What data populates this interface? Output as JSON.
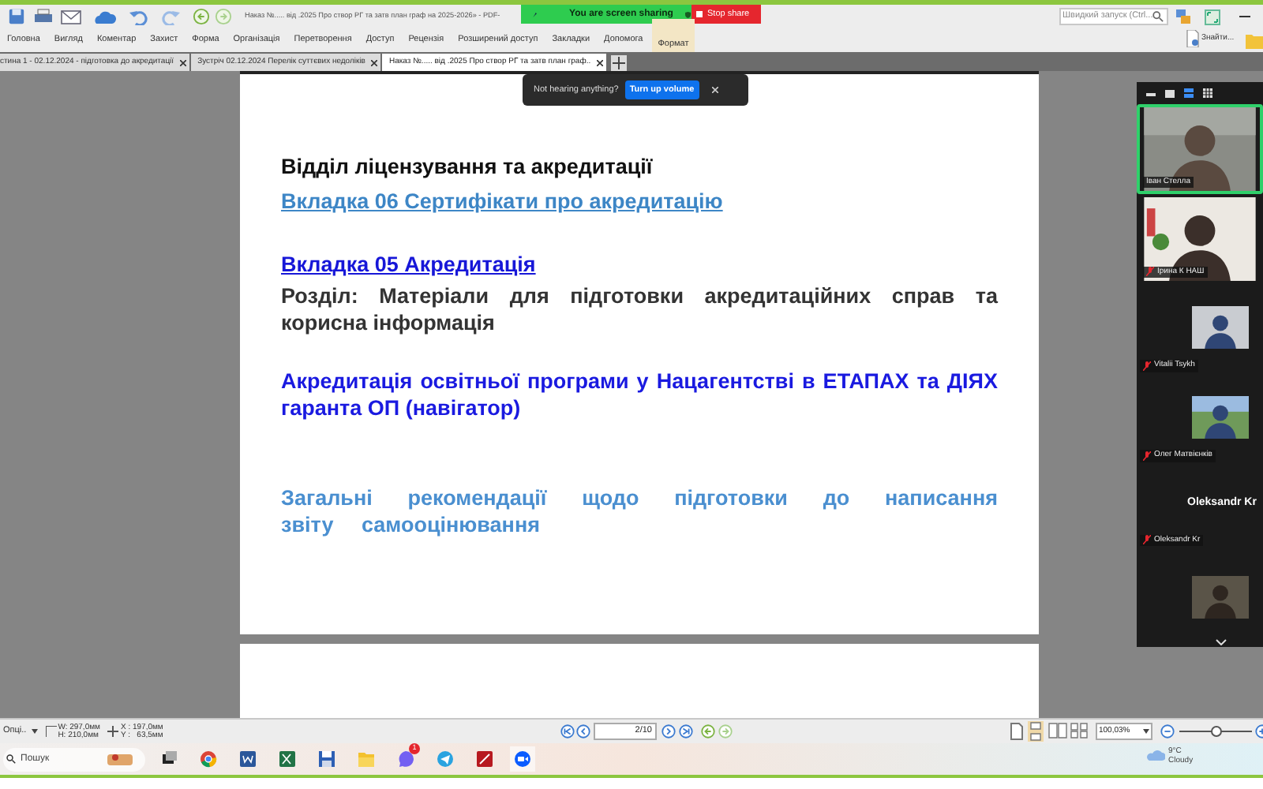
{
  "window": {
    "title": "Наказ №..... від .2025  Про створ РГ та затв план граф на 2025-2026» - PDF-"
  },
  "sharing_banner": {
    "text": "You are screen sharing",
    "stop_label": "Stop share"
  },
  "quick_launch": {
    "placeholder": "Швидкий запуск (Ctrl..."
  },
  "menu": [
    {
      "label": "Головна",
      "kind": "tab"
    },
    {
      "label": "Вигляд",
      "kind": "tab"
    },
    {
      "label": "Коментар",
      "kind": "tab"
    },
    {
      "label": "Захист",
      "kind": "tab"
    },
    {
      "label": "Форма",
      "kind": "tab"
    },
    {
      "label": "Організація",
      "kind": "tab"
    },
    {
      "label": "Перетворення",
      "kind": "tab"
    },
    {
      "label": "Доступ",
      "kind": "tab"
    },
    {
      "label": "Рецензія",
      "kind": "tab"
    },
    {
      "label": "Розширений доступ",
      "kind": "tab"
    },
    {
      "label": "Закладки",
      "kind": "tab"
    },
    {
      "label": "Допомога",
      "kind": "tab"
    },
    {
      "label": "Формат",
      "kind": "context"
    }
  ],
  "find_button": "Знайти...",
  "doc_tabs": [
    {
      "label": "стина 1 - 02.12.2024  - підготовка до акредитації",
      "selected": false
    },
    {
      "label": "Зустріч 02.12.2024 Перелік суттєвих недоліків",
      "selected": false
    },
    {
      "label": "Наказ №..... від .2025  Про створ РГ та затв план граф..",
      "selected": true
    }
  ],
  "notice": {
    "text": "Not hearing anything?",
    "button": "Turn up volume"
  },
  "document": {
    "blocks": [
      {
        "kind": "title",
        "text": "Відділ ліцензування та акредитації"
      },
      {
        "kind": "link-muted",
        "text": "Вкладка 06 Сертифікати про акредитацію"
      },
      {
        "kind": "link",
        "text": "Вкладка 05 Акредитація"
      },
      {
        "kind": "section",
        "text": "Розділ: Матеріали для підготовки акредитаційних справ та корисна інформація"
      },
      {
        "kind": "strong",
        "text": "Акредитація освітньої програми у Нацагентстві в ЕТАПАХ та ДІЯХ гаранта ОП (навігатор)"
      },
      {
        "kind": "note",
        "text": "Загальні рекомендації щодо підготовки до написання звіту самооцінювання"
      }
    ]
  },
  "participants": [
    {
      "kind": "video",
      "name": "Іван Стелла",
      "speaking": true,
      "muted": false
    },
    {
      "kind": "video",
      "name": "Ірина К НАШ",
      "speaking": false,
      "muted": true
    },
    {
      "name": "Vitalii Tsykh",
      "speaking": false,
      "muted": true
    },
    {
      "name": "Олег Матвієнків",
      "speaking": false,
      "muted": true
    },
    {
      "kind": "name",
      "display_name": "Oleksandr Kr",
      "name": "Oleksandr Kr",
      "speaking": false,
      "muted": true
    },
    {
      "kind": "partial"
    }
  ],
  "status_bar": {
    "options": "Опці..",
    "width": "W: 297,0мм",
    "height": "H: 210,0мм",
    "x": "X : 197,0мм",
    "y": "Y :   63,5мм",
    "page": "2/10",
    "zoom": "100,03%",
    "zoom_level": {
      "level": 0.5
    }
  },
  "taskbar": {
    "search": "Пошук",
    "badge": "1",
    "temperature": "9°C",
    "weather": "Cloudy"
  }
}
